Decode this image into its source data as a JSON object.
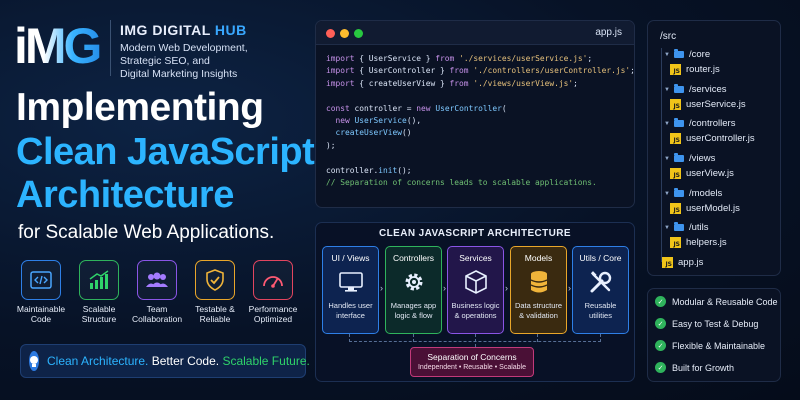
{
  "brand": {
    "logo_text": "iMG",
    "name_main": "IMG DIGITAL ",
    "name_accent": "HUB",
    "tagline": [
      "Modern Web Development,",
      "Strategic SEO, and",
      "Digital Marketing Insights"
    ]
  },
  "headline": {
    "line1": "Implementing",
    "line2": "Clean JavaScript",
    "line3": "Architecture",
    "subtitle": "for Scalable Web Applications."
  },
  "features": [
    {
      "icon": "code-icon",
      "label": "Maintainable Code",
      "color": "#2e7fe6"
    },
    {
      "icon": "bar-chart-icon",
      "label": "Scalable Structure",
      "color": "#2fb35c"
    },
    {
      "icon": "team-icon",
      "label": "Team Collaboration",
      "color": "#8a55e6"
    },
    {
      "icon": "shield-check-icon",
      "label": "Testable & Reliable",
      "color": "#e9a62a"
    },
    {
      "icon": "gauge-icon",
      "label": "Performance Optimized",
      "color": "#e2455f"
    }
  ],
  "tagline_bar": {
    "icon": "lightbulb-icon",
    "part1": "Clean Architecture.",
    "part2": " Better Code.",
    "part3": " Scalable Future.",
    "colors": {
      "part1": "#2cb4ff",
      "part2": "#ffffff",
      "part3": "#2fd36a"
    }
  },
  "code_window": {
    "file": "app.js",
    "dots": [
      "#ff5f57",
      "#febc2e",
      "#28c840"
    ]
  },
  "file_tree": {
    "root": "/src",
    "items": [
      {
        "type": "folder",
        "label": "/core"
      },
      {
        "type": "file",
        "label": "router.js"
      },
      {
        "type": "folder",
        "label": "/services"
      },
      {
        "type": "file",
        "label": "userService.js"
      },
      {
        "type": "folder",
        "label": "/controllers"
      },
      {
        "type": "file",
        "label": "userController.js"
      },
      {
        "type": "folder",
        "label": "/views"
      },
      {
        "type": "file",
        "label": "userView.js"
      },
      {
        "type": "folder",
        "label": "/models"
      },
      {
        "type": "file",
        "label": "userModel.js"
      },
      {
        "type": "folder",
        "label": "/utils"
      },
      {
        "type": "file",
        "label": "helpers.js"
      },
      {
        "type": "file",
        "label": "app.js"
      }
    ]
  },
  "benefits": [
    "Modular & Reusable Code",
    "Easy to Test & Debug",
    "Flexible & Maintainable",
    "Built for Growth"
  ],
  "architecture": {
    "title": "CLEAN JAVASCRIPT ARCHITECTURE",
    "columns": [
      {
        "title": "UI / Views",
        "icon": "monitor-icon",
        "desc": [
          "Handles user",
          "interface"
        ],
        "color": "#2e7fe6",
        "bg": "#0d2350"
      },
      {
        "title": "Controllers",
        "icon": "gear-icon",
        "desc": [
          "Manages app",
          "logic & flow"
        ],
        "color": "#2fb35c",
        "bg": "#0c2a2a"
      },
      {
        "title": "Services",
        "icon": "cube-icon",
        "desc": [
          "Business logic",
          "& operations"
        ],
        "color": "#8a55e6",
        "bg": "#22164a"
      },
      {
        "title": "Models",
        "icon": "database-icon",
        "desc": [
          "Data structure",
          "& validation"
        ],
        "color": "#e9a62a",
        "bg": "#3a2a10"
      },
      {
        "title": "Utils / Core",
        "icon": "tools-icon",
        "desc": [
          "Reusable",
          "utilities"
        ],
        "color": "#2e7fe6",
        "bg": "#0d2350"
      }
    ],
    "soc_title": "Separation of Concerns",
    "soc_sub": "Independent • Reusable • Scalable"
  }
}
